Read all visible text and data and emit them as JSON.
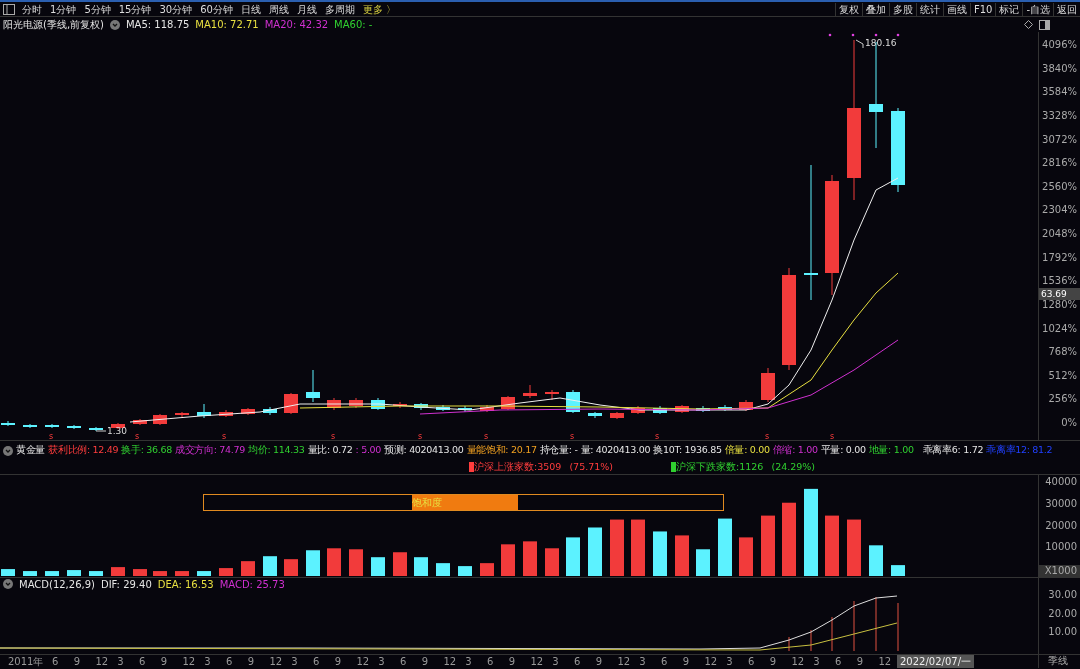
{
  "toolbar": {
    "periods": [
      "分时",
      "1分钟",
      "5分钟",
      "15分钟",
      "30分钟",
      "60分钟",
      "日线",
      "周线",
      "月线",
      "多周期"
    ],
    "more": "更多 〉",
    "actions": [
      "复权",
      "叠加",
      "多股",
      "统计",
      "画线",
      "F10",
      "标记",
      "-自选",
      "返回"
    ]
  },
  "chart_header": {
    "title": "阳光电源(季线,前复权)",
    "ma": [
      {
        "label": "MA5: 118.75",
        "color": "#e6e6e6"
      },
      {
        "label": "MA10: 72.71",
        "color": "#e8e040"
      },
      {
        "label": "MA20: 42.32",
        "color": "#d030d0"
      },
      {
        "label": "MA60: -",
        "color": "#30d030"
      }
    ]
  },
  "price_chart": {
    "axis_labels": [
      "4096%",
      "3840%",
      "3584%",
      "3328%",
      "3072%",
      "2816%",
      "2560%",
      "2304%",
      "2048%",
      "1792%",
      "1536%",
      "1280%",
      "1024%",
      "768%",
      "512%",
      "256%",
      "0%"
    ],
    "current_price": "63.69",
    "high_label": "180.16",
    "low_label": "1.30",
    "signal_marks": [
      "s",
      "s",
      "s",
      "s",
      "s",
      "s",
      "s",
      "s",
      "s",
      "s"
    ]
  },
  "indicator_bar": {
    "title": "黄金量",
    "items": [
      {
        "label": "获利比例: 12.49"
      },
      {
        "label": "换手: 36.68"
      },
      {
        "label": "成交方向: 74.79"
      },
      {
        "label": "均价: 114.33"
      },
      {
        "label": "量比: 0.72"
      },
      {
        "label": ": 5.00"
      },
      {
        "label": "预测: 4020413.00"
      },
      {
        "label": "量能饱和: 20.17"
      },
      {
        "label": "持仓量: -"
      },
      {
        "label": "量: 4020413.00"
      },
      {
        "label": "换10T: 1936.85"
      },
      {
        "label": "倍量: 0.00"
      },
      {
        "label": "倍缩: 1.00"
      },
      {
        "label": "平量: 0.00"
      },
      {
        "label": "地量: 1.00"
      },
      {
        "label": "乖离率6: 1.72"
      },
      {
        "label": "乖离率12: 81.2"
      }
    ]
  },
  "breadth": [
    {
      "label": "沪深上涨家数:3509",
      "percent": "(75.71%)",
      "color": "#ff3d3d"
    },
    {
      "label": "沪深下跌家数:1126",
      "percent": "(24.29%)",
      "color": "#30d030"
    }
  ],
  "volume": {
    "saturation": {
      "label": "饱和度"
    },
    "axis_labels": [
      "40000",
      "30000",
      "20000",
      "10000"
    ],
    "unit": "X1000"
  },
  "macd": {
    "title": "MACD(12,26,9)",
    "items": [
      {
        "label": "DIF: 29.40",
        "color": "#e6e6e6"
      },
      {
        "label": "DEA: 16.53",
        "color": "#e8e040"
      },
      {
        "label": "MACD: 25.73",
        "color": "#d030d0"
      }
    ],
    "axis_labels": [
      "30.00",
      "20.00",
      "10.00"
    ]
  },
  "time_axis": {
    "labels": [
      "2011年",
      "6",
      "9",
      "12",
      "3",
      "6",
      "9",
      "12",
      "3",
      "6",
      "9",
      "12",
      "3",
      "6",
      "9",
      "12",
      "3",
      "6",
      "9",
      "12",
      "3",
      "6",
      "9",
      "12",
      "3",
      "6",
      "9",
      "12",
      "3",
      "6",
      "9",
      "12",
      "3",
      "6",
      "9",
      "12",
      "3",
      "6",
      "9",
      "12"
    ],
    "cursor_date": "2022/02/07/一",
    "period": "季线"
  }
}
